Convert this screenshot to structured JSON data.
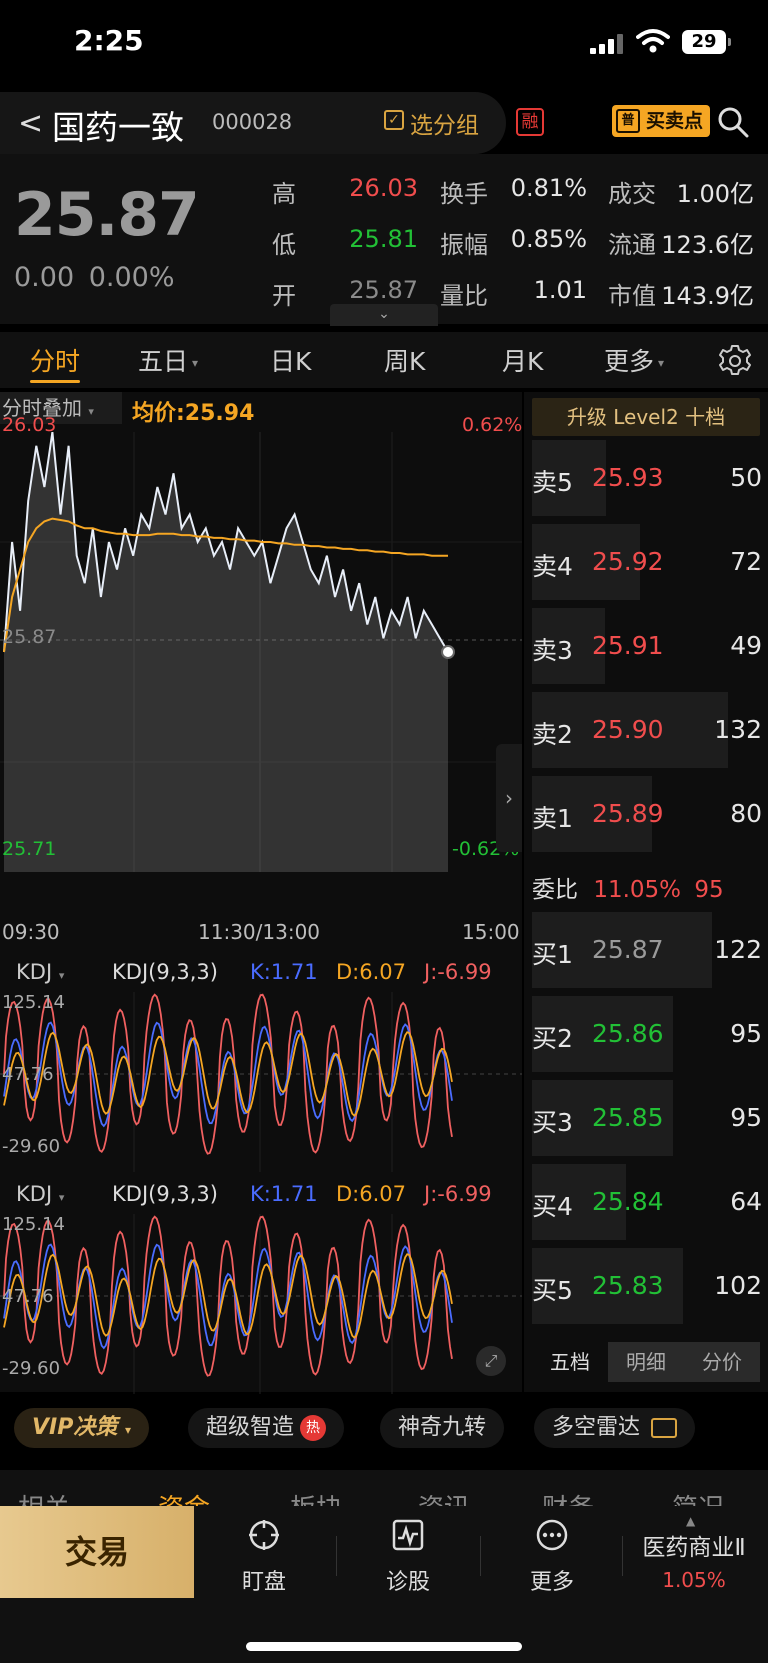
{
  "status": {
    "time": "2:25",
    "battery": "29"
  },
  "header": {
    "back": "<",
    "name": "国药一致",
    "code": "000028",
    "group_btn": "选分组",
    "margin_badge": "融",
    "buy_sell_badge": "普",
    "buy_sell_btn": "买卖点"
  },
  "quote": {
    "price": "25.87",
    "change": "0.00",
    "change_pct": "0.00%",
    "high_label": "高",
    "high": "26.03",
    "low_label": "低",
    "low": "25.81",
    "open_label": "开",
    "open": "25.87",
    "turnover_label": "换手",
    "turnover": "0.81%",
    "amplitude_label": "振幅",
    "amplitude": "0.85%",
    "vol_ratio_label": "量比",
    "vol_ratio": "1.01",
    "amount_label": "成交",
    "amount": "1.00亿",
    "float_label": "流通",
    "float": "123.6亿",
    "mcap_label": "市值",
    "mcap": "143.9亿"
  },
  "tabs": [
    {
      "label": "分时"
    },
    {
      "label": "五日"
    },
    {
      "label": "日K"
    },
    {
      "label": "周K"
    },
    {
      "label": "月K"
    },
    {
      "label": "更多"
    }
  ],
  "chart": {
    "overlay_btn": "分时叠加",
    "avg_label": "均价:25.94",
    "y_top": "26.03",
    "y_mid": "25.87",
    "y_bottom": "25.71",
    "pct_top": "0.62%",
    "pct_bottom": "-0.62%",
    "x_start": "09:30",
    "x_mid": "11:30/13:00",
    "x_end": "15:00",
    "kdj_btn": "KDJ",
    "kdj_params": "KDJ(9,3,3)",
    "kdj_k": "K:1.71",
    "kdj_d": "D:6.07",
    "kdj_j": "J:-6.99",
    "kdj_y_top": "125.14",
    "kdj_y_mid": "47.76",
    "kdj_y_bottom": "-29.60"
  },
  "chart_data": {
    "type": "line",
    "x_range": [
      "09:30",
      "15:00"
    ],
    "ylim": [
      25.71,
      26.03
    ],
    "series": [
      {
        "values": [
          25.87,
          25.95,
          25.9,
          25.98,
          26.02,
          25.99,
          26.03,
          25.97,
          26.02,
          25.94,
          25.92,
          25.96,
          25.91,
          25.95,
          25.93,
          25.96,
          25.94,
          25.97,
          25.96,
          25.99,
          25.97,
          26.0,
          25.96,
          25.97,
          25.95,
          25.96,
          25.94,
          25.95,
          25.93,
          25.96,
          25.95,
          25.94,
          25.95,
          25.92,
          25.94,
          25.96,
          25.97,
          25.95,
          25.93,
          25.92,
          25.94,
          25.91,
          25.93,
          25.9,
          25.92,
          25.89,
          25.91,
          25.88,
          25.9,
          25.89,
          25.91,
          25.88,
          25.9,
          25.89,
          25.88,
          25.87
        ]
      },
      {
        "values": [
          25.87,
          25.91,
          25.93,
          25.95,
          25.96,
          25.965,
          25.967,
          25.966,
          25.965,
          25.962,
          25.96,
          25.96,
          25.958,
          25.957,
          25.956,
          25.956,
          25.955,
          25.955,
          25.955,
          25.956,
          25.956,
          25.956,
          25.955,
          25.955,
          25.954,
          25.954,
          25.953,
          25.953,
          25.952,
          25.952,
          25.951,
          25.951,
          25.95,
          25.95,
          25.949,
          25.949,
          25.948,
          25.948,
          25.947,
          25.947,
          25.946,
          25.946,
          25.945,
          25.945,
          25.944,
          25.944,
          25.943,
          25.943,
          25.942,
          25.942,
          25.941,
          25.941,
          25.941,
          25.94,
          25.94,
          25.94
        ]
      }
    ]
  },
  "book": {
    "level2_btn": "升级 Level2 十档",
    "asks": [
      {
        "label": "卖5",
        "price": "25.93",
        "vol": "50",
        "w": 0.38
      },
      {
        "label": "卖4",
        "price": "25.92",
        "vol": "72",
        "w": 0.55
      },
      {
        "label": "卖3",
        "price": "25.91",
        "vol": "49",
        "w": 0.37
      },
      {
        "label": "卖2",
        "price": "25.90",
        "vol": "132",
        "w": 1.0
      },
      {
        "label": "卖1",
        "price": "25.89",
        "vol": "80",
        "w": 0.61
      }
    ],
    "weibi_label": "委比",
    "weibi_pct": "11.05%",
    "weibi_val": "95",
    "bids": [
      {
        "label": "买1",
        "price": "25.87",
        "vol": "122",
        "w": 0.92
      },
      {
        "label": "买2",
        "price": "25.86",
        "vol": "95",
        "w": 0.72
      },
      {
        "label": "买3",
        "price": "25.85",
        "vol": "95",
        "w": 0.72
      },
      {
        "label": "买4",
        "price": "25.84",
        "vol": "64",
        "w": 0.48
      },
      {
        "label": "买5",
        "price": "25.83",
        "vol": "102",
        "w": 0.77
      }
    ],
    "tabs": [
      "五档",
      "明细",
      "分价"
    ]
  },
  "features": {
    "vip": "VIP决策",
    "smart": "超级智造",
    "hot_badge": "热",
    "nine": "神奇九转",
    "radar": "多空雷达"
  },
  "subtabs": [
    "相关",
    "资金",
    "板块",
    "资讯",
    "财务",
    "简况"
  ],
  "bottom": {
    "trade": "交易",
    "watch": "盯盘",
    "diagnose": "诊股",
    "more": "更多",
    "sector_name": "医药商业Ⅱ",
    "sector_pct": "1.05%"
  },
  "colors": {
    "up": "#f04d4d",
    "down": "#22c036",
    "accent": "#f5a623",
    "kdj_k": "#4a6cff",
    "kdj_d": "#f5a623",
    "kdj_j": "#f06060"
  }
}
